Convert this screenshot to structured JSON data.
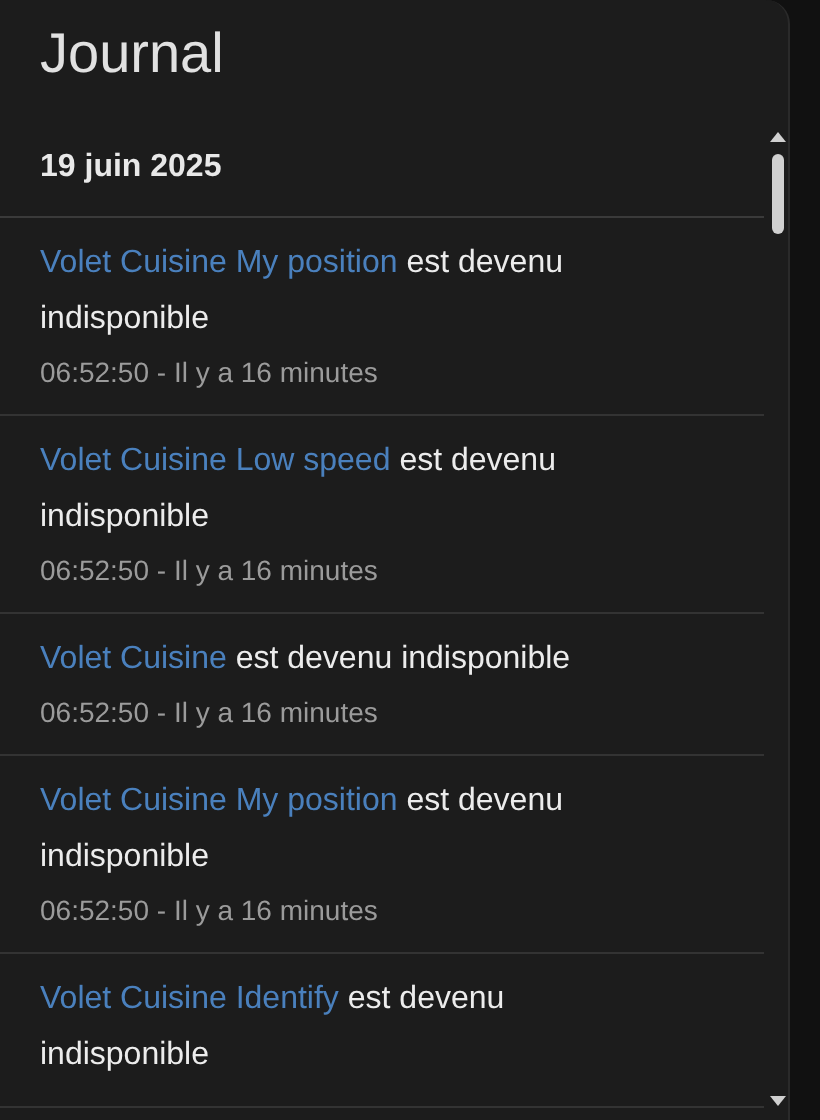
{
  "title": "Journal",
  "date_header": "19 juin 2025",
  "entries": [
    {
      "entity": "Volet Cuisine My position",
      "message": "est devenu indisponible",
      "time": "06:52:50 - Il y a 16 minutes"
    },
    {
      "entity": "Volet Cuisine Low speed",
      "message": "est devenu indisponible",
      "time": "06:52:50 - Il y a 16 minutes"
    },
    {
      "entity": "Volet Cuisine",
      "message": "est devenu indisponible",
      "time": "06:52:50 - Il y a 16 minutes"
    },
    {
      "entity": "Volet Cuisine My position",
      "message": "est devenu indisponible",
      "time": "06:52:50 - Il y a 16 minutes"
    },
    {
      "entity": "Volet Cuisine Identify",
      "message": "est devenu indisponible"
    }
  ]
}
